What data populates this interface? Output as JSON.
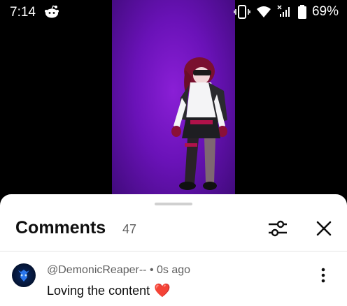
{
  "status_bar": {
    "time": "7:14",
    "battery": "69%",
    "icons": [
      "reddit-icon",
      "vibrate-icon",
      "wifi-icon",
      "signal-icon",
      "battery-icon"
    ]
  },
  "video": {
    "background_color": "#6a12b8"
  },
  "comments_sheet": {
    "title": "Comments",
    "count": "47",
    "icons": [
      "filter-icon",
      "close-icon"
    ]
  },
  "comments": [
    {
      "author": "@DemonicReaper--",
      "time": "0s ago",
      "meta": "@DemonicReaper-- • 0s ago",
      "text": "Loving the content",
      "emoji": "❤️"
    }
  ],
  "colors": {
    "accent_text": "#0f0f0f",
    "secondary_text": "#606060",
    "heart": "#e0231a"
  }
}
